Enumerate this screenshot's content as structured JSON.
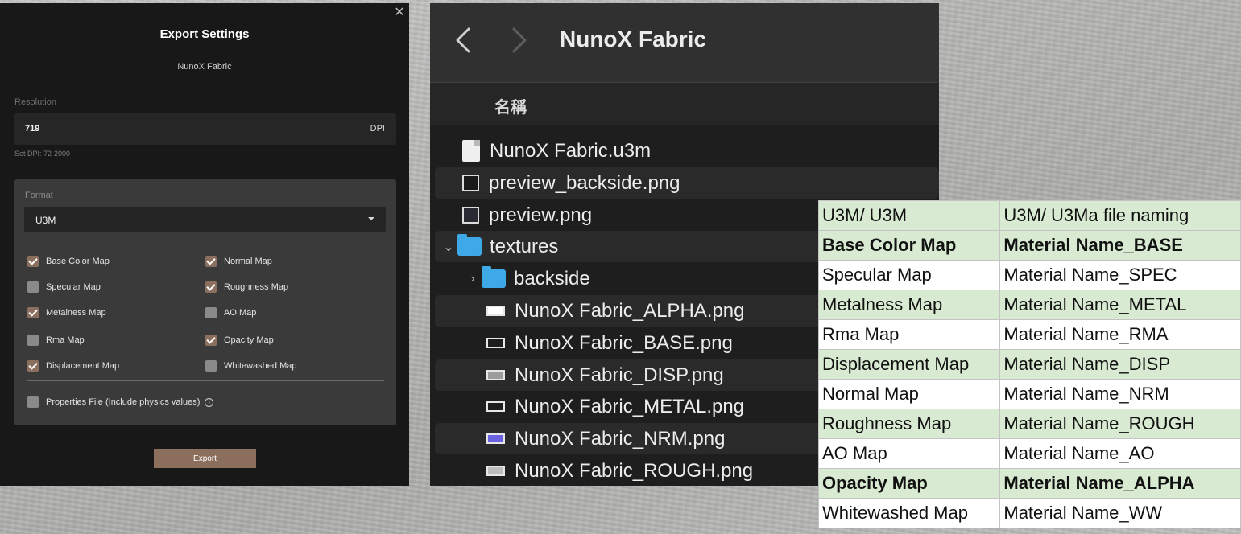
{
  "export_dialog": {
    "close_icon": "close-icon",
    "title": "Export Settings",
    "subtitle": "NunoX Fabric",
    "resolution_label": "Resolution",
    "resolution_value": "719",
    "resolution_unit": "DPI",
    "resolution_hint": "Set DPI: 72-2000",
    "format_label": "Format",
    "format_value": "U3M",
    "maps": [
      {
        "label": "Base Color Map",
        "checked": true
      },
      {
        "label": "Normal Map",
        "checked": true
      },
      {
        "label": "Specular Map",
        "checked": false
      },
      {
        "label": "Roughness Map",
        "checked": true
      },
      {
        "label": "Metalness Map",
        "checked": true
      },
      {
        "label": "AO Map",
        "checked": false
      },
      {
        "label": "Rma Map",
        "checked": false
      },
      {
        "label": "Opacity Map",
        "checked": true
      },
      {
        "label": "Displacement Map",
        "checked": true
      },
      {
        "label": "Whitewashed Map",
        "checked": false
      }
    ],
    "properties_file": {
      "label": "Properties File (Include physics values)",
      "checked": false
    },
    "export_label": "Export",
    "colors": {
      "accent": "#8b6f5c",
      "background": "#181818",
      "panel": "#3a3a3a"
    }
  },
  "finder": {
    "title": "NunoX Fabric",
    "column_name": "名稱",
    "rows": [
      {
        "name": "NunoX Fabric.u3m",
        "icon": "document-icon"
      },
      {
        "name": "preview_backside.png",
        "icon": "image-file-icon"
      },
      {
        "name": "preview.png",
        "icon": "image-file-icon"
      },
      {
        "name": "textures",
        "icon": "folder-icon",
        "expanded": true
      },
      {
        "name": "backside",
        "icon": "folder-icon",
        "expanded": false
      },
      {
        "name": "NunoX Fabric_ALPHA.png",
        "icon": "image-file-icon"
      },
      {
        "name": "NunoX Fabric_BASE.png",
        "icon": "image-file-icon"
      },
      {
        "name": "NunoX Fabric_DISP.png",
        "icon": "image-file-icon"
      },
      {
        "name": "NunoX Fabric_METAL.png",
        "icon": "image-file-icon"
      },
      {
        "name": "NunoX Fabric_NRM.png",
        "icon": "image-file-icon"
      },
      {
        "name": "NunoX Fabric_ROUGH.png",
        "icon": "image-file-icon"
      }
    ],
    "colors": {
      "folder": "#3da9e6",
      "nrm_thumb": "#6a62e0"
    }
  },
  "naming_table": {
    "header": [
      "U3M/ U3M",
      "U3M/ U3Ma file naming"
    ],
    "rows": [
      [
        "Base Color Map",
        "Material Name_BASE"
      ],
      [
        "Specular Map",
        "Material Name_SPEC"
      ],
      [
        "Metalness Map",
        "Material Name_METAL"
      ],
      [
        "Rma Map",
        "Material Name_RMA"
      ],
      [
        "Displacement Map",
        "Material Name_DISP"
      ],
      [
        "Normal Map",
        "Material Name_NRM"
      ],
      [
        "Roughness Map",
        "Material Name_ROUGH"
      ],
      [
        "AO Map",
        "Material Name_AO"
      ],
      [
        "Opacity Map",
        "Material Name_ALPHA"
      ],
      [
        "Whitewashed Map",
        "Material Name_WW"
      ]
    ],
    "colors": {
      "highlight": "#d8ead1"
    }
  }
}
